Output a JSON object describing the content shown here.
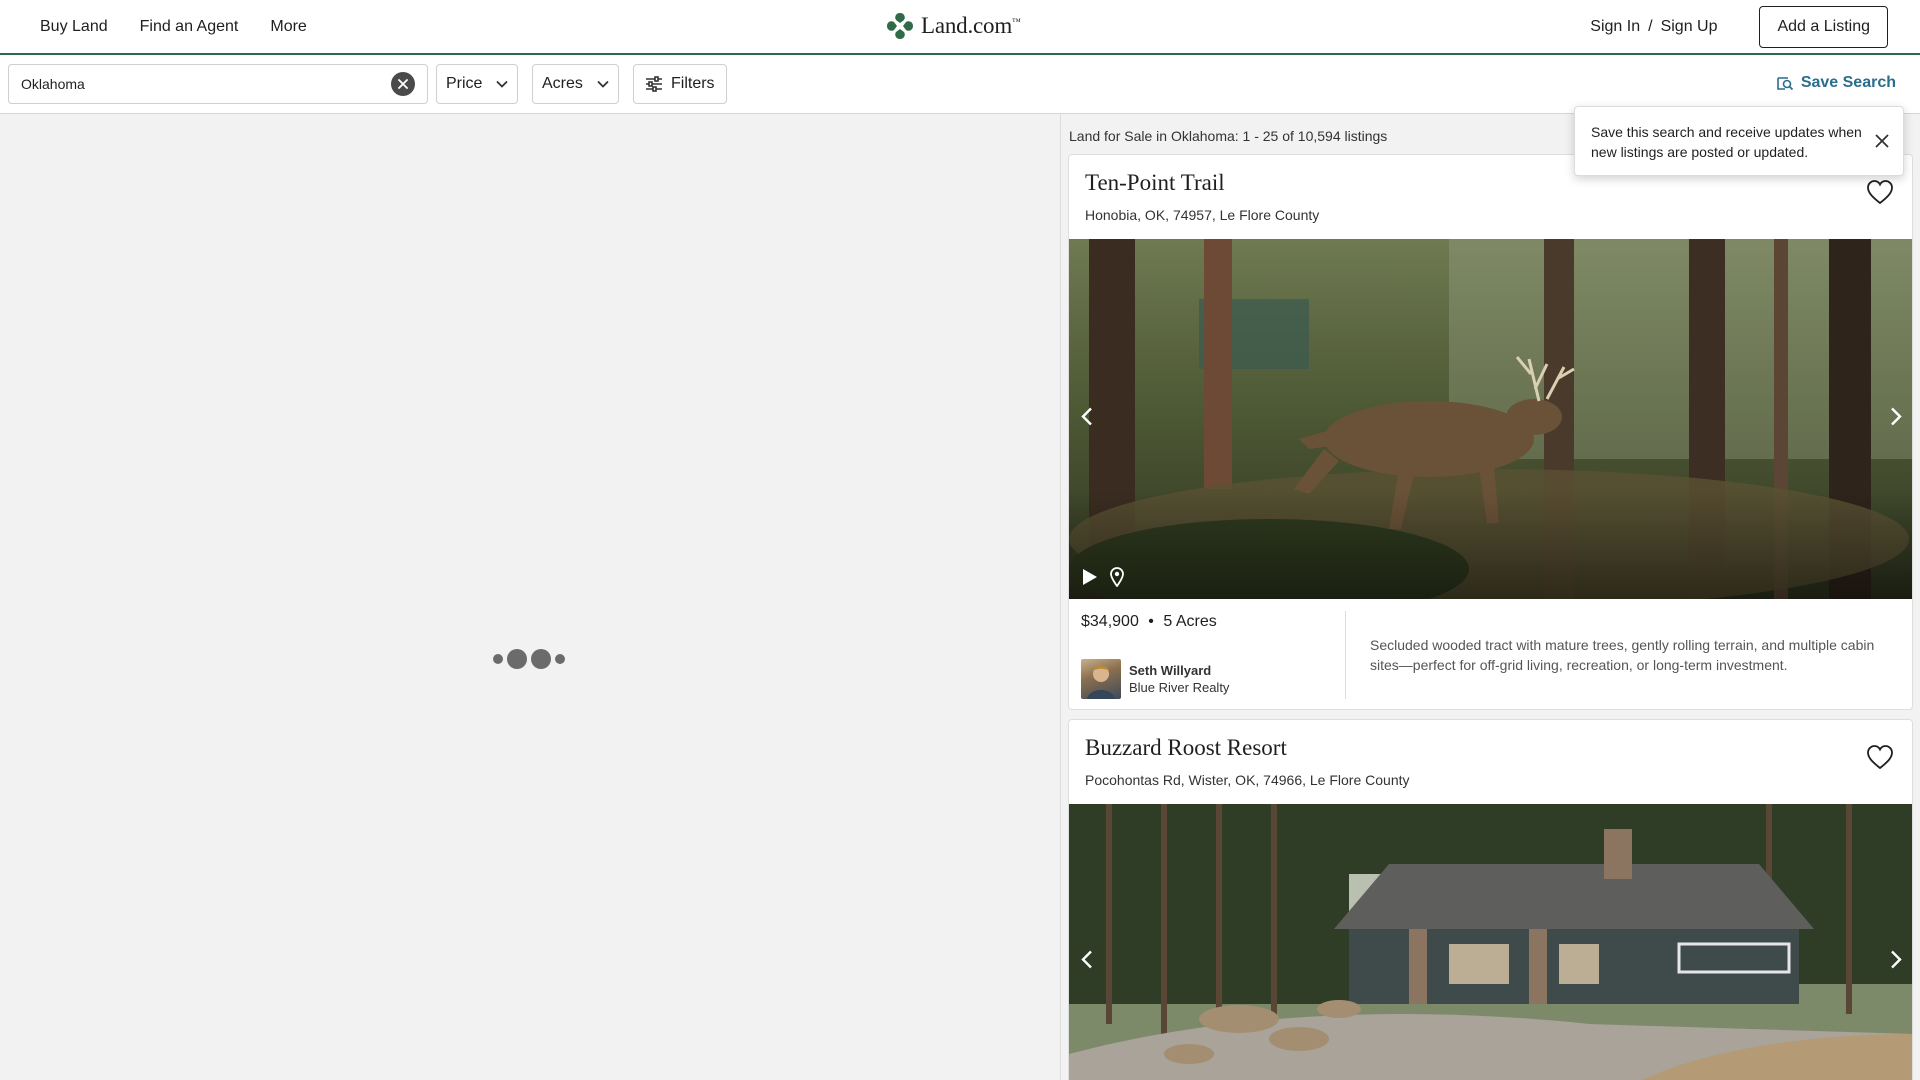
{
  "header": {
    "nav": [
      "Buy Land",
      "Find an Agent",
      "More"
    ],
    "logo_text": "Land.com",
    "logo_mark": "™",
    "sign_in": "Sign In",
    "separator": "/",
    "sign_up": "Sign Up",
    "add_listing": "Add a Listing"
  },
  "filters": {
    "search_value": "Oklahoma",
    "price_label": "Price",
    "acres_label": "Acres",
    "filters_label": "Filters",
    "save_search": "Save Search"
  },
  "tooltip": {
    "text": "Save this search and receive updates when new listings are posted or updated."
  },
  "results": {
    "summary": "Land for Sale in Oklahoma: 1 - 25 of 10,594 listings"
  },
  "listings": [
    {
      "title": "Ten-Point Trail",
      "address": "Honobia, OK, 74957, Le Flore County",
      "price": "$34,900",
      "bullet": "•",
      "acres": "5 Acres",
      "agent_name": "Seth Willyard",
      "agent_firm": "Blue River Realty",
      "description": "Secluded wooded tract with mature trees, gently rolling terrain, and multiple cabin sites—perfect for off-grid living, recreation, or long-term investment."
    },
    {
      "title": "Buzzard Roost Resort",
      "address": "Pocohontas Rd, Wister, OK, 74966, Le Flore County"
    }
  ],
  "colors": {
    "brand_green": "#2e6b46",
    "save_search_blue": "#2a6e8c",
    "map_background": "#f2f2f2"
  }
}
